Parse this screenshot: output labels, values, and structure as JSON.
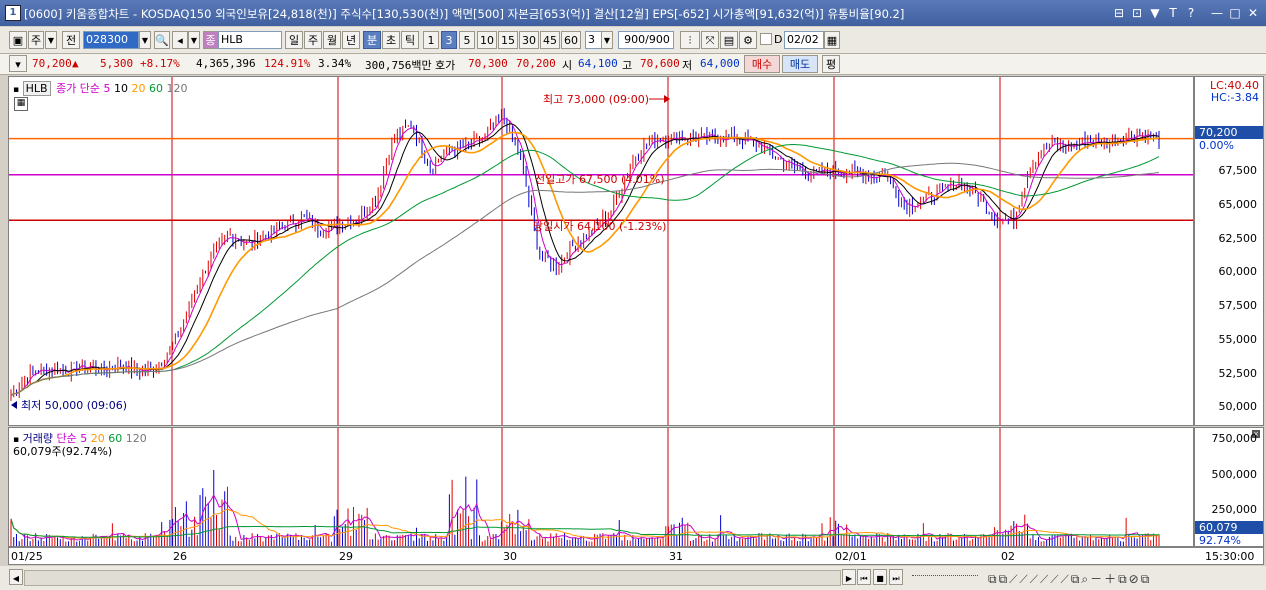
{
  "window": {
    "number": "1",
    "title": "[0600] 키움종합차트 - KOSDAQ150 외국인보유[24,818(천)] 주식수[130,530(천)] 액면[500] 자본금[653(억)] 결산[12월] EPS[-652] 시가총액[91,632(억)] 유통비율[90.2]",
    "controls": [
      "⊟",
      "⊡",
      "▼",
      "T",
      "?",
      "—",
      "□",
      "✕"
    ]
  },
  "toolbar": {
    "period_type": "주",
    "prev": "전",
    "code": "028300",
    "stock_name": "HLB",
    "stock_badge": "종",
    "period_buttons": [
      "일",
      "주",
      "월",
      "년",
      "분",
      "초",
      "틱"
    ],
    "selected_period": "분",
    "interval_buttons": [
      "1",
      "3",
      "5",
      "10",
      "15",
      "30",
      "45",
      "60"
    ],
    "selected_interval": "3",
    "interval_value": "3",
    "count": "900/900",
    "checkbox_label": "D",
    "date": "02/02"
  },
  "quote": {
    "price": "70,200",
    "change_arrow": "▲",
    "change": "5,300",
    "change_pct": "+8.17%",
    "volume": "4,365,396",
    "volume_ratio": "124.91%",
    "turnover": "3.34%",
    "amount": "300,756백만",
    "bid_label": "호가",
    "bid": "70,300",
    "ask": "70,200",
    "open_label": "시",
    "open": "64,100",
    "high_label": "고",
    "high": "70,600",
    "low_label": "저",
    "low": "64,000",
    "buy_label": "매수",
    "sell_label": "매도",
    "eval_label": "평"
  },
  "price_panel": {
    "stock_label": "HLB",
    "legend_title": "종가 단순",
    "ma_labels": [
      "5",
      "10",
      "20",
      "60",
      "120"
    ],
    "ma_colors": [
      "#cc00cc",
      "#000000",
      "#ff9900",
      "#009933",
      "#777777"
    ],
    "high_annotation": "최고 73,000 (09:00)",
    "low_annotation": "최저 50,000 (09:06)",
    "prev_high_line_label": "전일고가 67,500 (4.01%)",
    "open_line_label": "당일시가 64,100 (-1.23%)",
    "lc_label": "LC:40.40",
    "hc_label": "HC:-3.84",
    "current_price_tag": "70,200",
    "current_pct_tag": "0.00%",
    "y_ticks": [
      "67,500",
      "65,000",
      "62,500",
      "60,000",
      "57,500",
      "55,000",
      "52,500",
      "50,000"
    ]
  },
  "volume_panel": {
    "legend_title": "거래량",
    "legend_type": "단순",
    "ma_labels": [
      "5",
      "20",
      "60",
      "120"
    ],
    "current_volume": "60,079주(92.74%)",
    "y_ticks": [
      "750,000",
      "500,000",
      "250,000"
    ],
    "current_tag": "60,079",
    "current_pct": "92.74%"
  },
  "x_axis": {
    "labels": [
      "01/25",
      "26",
      "29",
      "30",
      "31",
      "02/01",
      "02"
    ],
    "time": "15:30:00"
  },
  "chart_data": {
    "type": "line",
    "series_description": "3-minute candlestick price chart with moving averages",
    "x": [
      "01/25",
      "26",
      "29",
      "30",
      "31",
      "02/01",
      "02"
    ],
    "ylim": [
      48800,
      74800
    ],
    "reference_lines": [
      {
        "label": "전일고가",
        "value": 67500,
        "color": "#cc00cc"
      },
      {
        "label": "당일시가",
        "value": 64100,
        "color": "#cc0000"
      },
      {
        "label": "현재가",
        "value": 70200,
        "color": "#ff6600"
      }
    ],
    "close_path": [
      51000,
      52700,
      53000,
      52900,
      53200,
      52900,
      53300,
      52800,
      53100,
      55000,
      58500,
      61500,
      63000,
      62300,
      63000,
      63700,
      64300,
      63400,
      63900,
      64200,
      65600,
      70300,
      71200,
      68000,
      69400,
      69600,
      70300,
      72000,
      68500,
      61500,
      60700,
      62500,
      63400,
      64900,
      68400,
      70000,
      70300,
      70300,
      70200,
      70300,
      70200,
      69700,
      68800,
      68000,
      67500,
      67800,
      67700,
      67400,
      67600,
      65200,
      65600,
      66300,
      67000,
      66000,
      64300,
      64100,
      68400,
      69800,
      69600,
      70000,
      69900,
      70300,
      70600,
      70200
    ]
  }
}
